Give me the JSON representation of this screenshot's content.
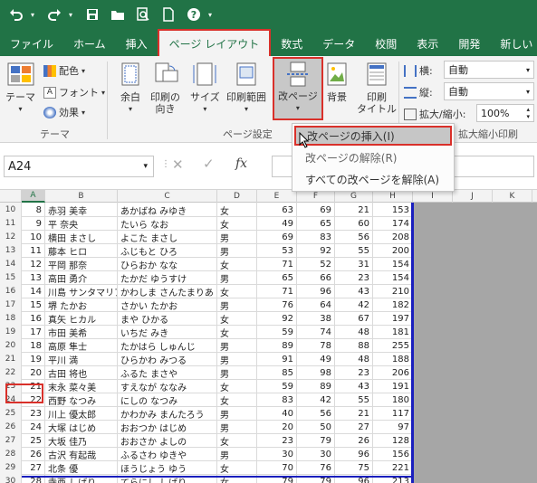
{
  "quick_access": {
    "undo_icon": "undo-icon",
    "redo_icon": "redo-icon",
    "save_icon": "save-icon",
    "open_icon": "folder-icon",
    "print_preview_icon": "print-preview-icon",
    "new_icon": "new-document-icon",
    "help_icon": "help-icon"
  },
  "tabs": [
    {
      "label": "ファイル",
      "active": false
    },
    {
      "label": "ホーム",
      "active": false
    },
    {
      "label": "挿入",
      "active": false
    },
    {
      "label": "ページ レイアウト",
      "active": true
    },
    {
      "label": "数式",
      "active": false
    },
    {
      "label": "データ",
      "active": false
    },
    {
      "label": "校閲",
      "active": false
    },
    {
      "label": "表示",
      "active": false
    },
    {
      "label": "開発",
      "active": false
    },
    {
      "label": "新しい",
      "active": false
    }
  ],
  "ribbon": {
    "theme_group": {
      "label": "テーマ",
      "theme_button": "テーマ",
      "colors": "配色",
      "fonts": "フォント",
      "effects": "効果"
    },
    "page_setup_group": {
      "label": "ページ設定",
      "margins": "余白",
      "orientation_line1": "印刷の",
      "orientation_line2": "向き",
      "size": "サイズ",
      "print_area_line1": "印刷範囲",
      "breaks": "改ページ",
      "background": "背景",
      "print_titles_line1": "印刷",
      "print_titles_line2": "タイトル"
    },
    "scale_group": {
      "label": "拡大縮小印刷",
      "width_label": "横:",
      "width_value": "自動",
      "height_label": "縦:",
      "height_value": "自動",
      "scale_label": "拡大/縮小:",
      "scale_value": "100%"
    }
  },
  "formula_bar": {
    "name_box": "A24",
    "fx": "fx"
  },
  "dropdown_menu": {
    "items": [
      {
        "label": "改ページの挿入(I)",
        "highlighted": true
      },
      {
        "label": "改ページの解除(R)",
        "highlighted": false
      },
      {
        "label": "すべての改ページを解除(A)",
        "highlighted": false
      }
    ]
  },
  "grid": {
    "columns": [
      "A",
      "B",
      "C",
      "D",
      "E",
      "F",
      "G",
      "H",
      "I",
      "J",
      "K"
    ],
    "selected_column": "A",
    "rows": [
      {
        "r": "10",
        "a": "8",
        "b": "赤羽 美幸",
        "c": "あかばね みゆき",
        "d": "女",
        "e": "63",
        "f": "69",
        "g": "21",
        "h": "153"
      },
      {
        "r": "11",
        "a": "9",
        "b": "平 奈央",
        "c": "たいら なお",
        "d": "女",
        "e": "49",
        "f": "65",
        "g": "60",
        "h": "174"
      },
      {
        "r": "12",
        "a": "10",
        "b": "横田 まさし",
        "c": "よこた まさし",
        "d": "男",
        "e": "69",
        "f": "83",
        "g": "56",
        "h": "208"
      },
      {
        "r": "13",
        "a": "11",
        "b": "藤本 ヒロ",
        "c": "ふじもと ひろ",
        "d": "男",
        "e": "53",
        "f": "92",
        "g": "55",
        "h": "200"
      },
      {
        "r": "14",
        "a": "12",
        "b": "平岡 那奈",
        "c": "ひらおか なな",
        "d": "女",
        "e": "71",
        "f": "52",
        "g": "31",
        "h": "154"
      },
      {
        "r": "15",
        "a": "13",
        "b": "高田 勇介",
        "c": "たかだ ゆうすけ",
        "d": "男",
        "e": "65",
        "f": "66",
        "g": "23",
        "h": "154"
      },
      {
        "r": "16",
        "a": "14",
        "b": "川島 サンタマリア",
        "c": "かわしま さんたまりあ",
        "d": "女",
        "e": "71",
        "f": "96",
        "g": "43",
        "h": "210"
      },
      {
        "r": "17",
        "a": "15",
        "b": "堺 たかお",
        "c": "さかい たかお",
        "d": "男",
        "e": "76",
        "f": "64",
        "g": "42",
        "h": "182"
      },
      {
        "r": "18",
        "a": "16",
        "b": "真矢 ヒカル",
        "c": "まや ひかる",
        "d": "女",
        "e": "92",
        "f": "38",
        "g": "67",
        "h": "197"
      },
      {
        "r": "19",
        "a": "17",
        "b": "市田 美希",
        "c": "いちだ みき",
        "d": "女",
        "e": "59",
        "f": "74",
        "g": "48",
        "h": "181"
      },
      {
        "r": "20",
        "a": "18",
        "b": "高原 隼士",
        "c": "たかはら しゅんじ",
        "d": "男",
        "e": "89",
        "f": "78",
        "g": "88",
        "h": "255"
      },
      {
        "r": "21",
        "a": "19",
        "b": "平川 満",
        "c": "ひらかわ みつる",
        "d": "男",
        "e": "91",
        "f": "49",
        "g": "48",
        "h": "188"
      },
      {
        "r": "22",
        "a": "20",
        "b": "古田 将也",
        "c": "ふるた まさや",
        "d": "男",
        "e": "85",
        "f": "98",
        "g": "23",
        "h": "206"
      },
      {
        "r": "23",
        "a": "21",
        "b": "末永 菜々美",
        "c": "すえなが ななみ",
        "d": "女",
        "e": "59",
        "f": "89",
        "g": "43",
        "h": "191"
      },
      {
        "r": "24",
        "a": "22",
        "b": "西野 なつみ",
        "c": "にしの なつみ",
        "d": "女",
        "e": "83",
        "f": "42",
        "g": "55",
        "h": "180"
      },
      {
        "r": "25",
        "a": "23",
        "b": "川上 優太郎",
        "c": "かわかみ まんたろう",
        "d": "男",
        "e": "40",
        "f": "56",
        "g": "21",
        "h": "117"
      },
      {
        "r": "26",
        "a": "24",
        "b": "大塚 はじめ",
        "c": "おおつか はじめ",
        "d": "男",
        "e": "20",
        "f": "50",
        "g": "27",
        "h": "97"
      },
      {
        "r": "27",
        "a": "25",
        "b": "大坂 佳乃",
        "c": "おおさか よしの",
        "d": "女",
        "e": "23",
        "f": "79",
        "g": "26",
        "h": "128"
      },
      {
        "r": "28",
        "a": "26",
        "b": "古沢 有起哉",
        "c": "ふるさわ ゆきや",
        "d": "男",
        "e": "30",
        "f": "30",
        "g": "96",
        "h": "156"
      },
      {
        "r": "29",
        "a": "27",
        "b": "北条 優",
        "c": "ほうじょう ゆう",
        "d": "女",
        "e": "70",
        "f": "76",
        "g": "75",
        "h": "221"
      },
      {
        "r": "30",
        "a": "28",
        "b": "寺西 しげり",
        "c": "てらにし しげり",
        "d": "女",
        "e": "79",
        "f": "79",
        "g": "96",
        "h": "213"
      }
    ]
  }
}
